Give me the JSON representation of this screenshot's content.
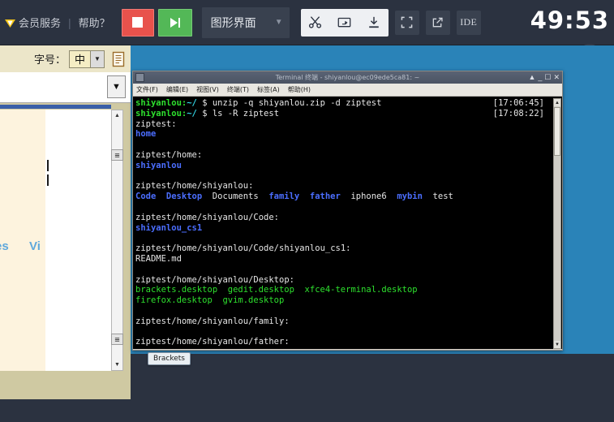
{
  "topbar": {
    "vip_label": "会员服务",
    "separator": "|",
    "help_label": "帮助？",
    "stop_button": "stop",
    "play_button": "play",
    "env_label": "图形界面",
    "icons": {
      "scissors": "scissors-icon",
      "screenshot": "screenshot-icon",
      "download": "download-icon",
      "fullscreen": "fullscreen-icon",
      "external": "external-link-icon",
      "ide": "IDE"
    },
    "timer": "49:53",
    "eye": "eye-icon"
  },
  "left_panel": {
    "font_size_label": "字号：",
    "font_size_value": "中",
    "doc_icon": "document-icon",
    "clipped_text_1": "es",
    "clipped_text_2": "Vi"
  },
  "terminal": {
    "title": "Terminal 终端 - shiyanlou@ec09ede5ca81: ~",
    "window_controls": [
      "shade",
      "minimize",
      "maximize",
      "close"
    ],
    "menu": [
      "文件(F)",
      "编辑(E)",
      "视图(V)",
      "终端(T)",
      "标签(A)",
      "帮助(H)"
    ],
    "lines": [
      {
        "type": "cmd",
        "prompt": "shiyanlou:",
        "path": "~/",
        "dollar": " $ ",
        "cmd": "unzip -q shiyanlou.zip -d ziptest",
        "ts": "[17:06:45]"
      },
      {
        "type": "cmd",
        "prompt": "shiyanlou:",
        "path": "~/",
        "dollar": " $ ",
        "cmd": "ls -R ziptest",
        "ts": "[17:08:22]"
      },
      {
        "type": "plain",
        "text": "ziptest:"
      },
      {
        "type": "dir",
        "text": "home"
      },
      {
        "type": "blank",
        "text": ""
      },
      {
        "type": "plain",
        "text": "ziptest/home:"
      },
      {
        "type": "dir",
        "text": "shiyanlou"
      },
      {
        "type": "blank",
        "text": ""
      },
      {
        "type": "plain",
        "text": "ziptest/home/shiyanlou:"
      },
      {
        "type": "listing",
        "items": [
          {
            "name": "Code",
            "kind": "dir"
          },
          {
            "name": "Desktop",
            "kind": "dir"
          },
          {
            "name": "Documents",
            "kind": "file"
          },
          {
            "name": "family",
            "kind": "dir"
          },
          {
            "name": "father",
            "kind": "dir"
          },
          {
            "name": "iphone6",
            "kind": "file"
          },
          {
            "name": "mybin",
            "kind": "dir"
          },
          {
            "name": "test",
            "kind": "file"
          }
        ]
      },
      {
        "type": "blank",
        "text": ""
      },
      {
        "type": "plain",
        "text": "ziptest/home/shiyanlou/Code:"
      },
      {
        "type": "dir",
        "text": "shiyanlou_cs1"
      },
      {
        "type": "blank",
        "text": ""
      },
      {
        "type": "plain",
        "text": "ziptest/home/shiyanlou/Code/shiyanlou_cs1:"
      },
      {
        "type": "plain",
        "text": "README.md"
      },
      {
        "type": "blank",
        "text": ""
      },
      {
        "type": "plain",
        "text": "ziptest/home/shiyanlou/Desktop:"
      },
      {
        "type": "listing",
        "items": [
          {
            "name": "brackets.desktop",
            "kind": "exec"
          },
          {
            "name": "gedit.desktop",
            "kind": "exec"
          },
          {
            "name": "xfce4-terminal.desktop",
            "kind": "exec"
          }
        ]
      },
      {
        "type": "listing",
        "items": [
          {
            "name": "firefox.desktop",
            "kind": "exec"
          },
          {
            "name": "gvim.desktop",
            "kind": "exec"
          }
        ]
      },
      {
        "type": "blank",
        "text": ""
      },
      {
        "type": "plain",
        "text": "ziptest/home/shiyanlou/family:"
      },
      {
        "type": "blank",
        "text": ""
      },
      {
        "type": "plain",
        "text": "ziptest/home/shiyanlou/father:"
      }
    ]
  },
  "taskbar": {
    "item_label": "Brackets"
  },
  "colors": {
    "topbar_bg": "#2b3240",
    "stop_red": "#e8524c",
    "play_green": "#53b857",
    "desktop_blue": "#2a83b8",
    "terminal_bg": "#000000",
    "prompt_green": "#2ee02e",
    "path_cyan": "#33d6e6",
    "dir_blue": "#4b6eff",
    "exec_green": "#2ee02e"
  }
}
